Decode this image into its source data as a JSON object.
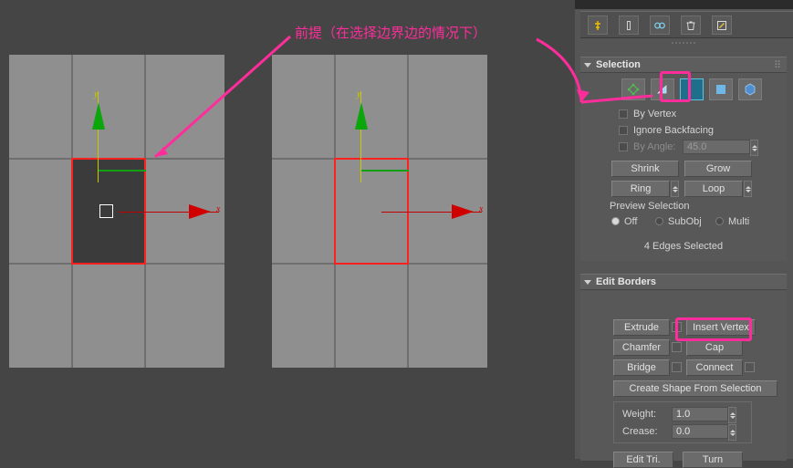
{
  "annotation": {
    "note": "前提（在选择边界边的情况下）",
    "color": "#ff2d9b"
  },
  "viewport": {
    "axis_y_label": "y",
    "axis_x_label": "x",
    "selection_color": "#ff2020"
  },
  "panel": {
    "toolbar": {
      "buttons": [
        {
          "name": "pin-stack-icon",
          "glyph": "⚑"
        },
        {
          "name": "column-icon",
          "glyph": "▍"
        },
        {
          "name": "link-icon",
          "glyph": "⚭"
        },
        {
          "name": "delete-icon",
          "glyph": "Ὕ1"
        },
        {
          "name": "edit-icon",
          "glyph": "✎"
        }
      ]
    },
    "selection": {
      "title": "Selection",
      "subobject_icons": [
        {
          "name": "vertex-icon",
          "label": "Vertex"
        },
        {
          "name": "edge-icon",
          "label": "Edge"
        },
        {
          "name": "border-icon",
          "label": "Border"
        },
        {
          "name": "polygon-icon",
          "label": "Polygon"
        },
        {
          "name": "element-icon",
          "label": "Element"
        }
      ],
      "active_subobject_index": 2,
      "by_vertex": "By Vertex",
      "ignore_backfacing": "Ignore Backfacing",
      "by_angle": "By Angle:",
      "by_angle_value": "45.0",
      "shrink": "Shrink",
      "grow": "Grow",
      "ring": "Ring",
      "loop": "Loop",
      "preview_selection": "Preview Selection",
      "preview_off": "Off",
      "preview_subobj": "SubObj",
      "preview_multi": "Multi",
      "status": "4 Edges Selected"
    },
    "edit_borders": {
      "title": "Edit Borders",
      "extrude": "Extrude",
      "insert_vertex": "Insert Vertex",
      "chamfer": "Chamfer",
      "cap": "Cap",
      "bridge": "Bridge",
      "connect": "Connect",
      "create_shape": "Create Shape From Selection",
      "weight_label": "Weight:",
      "weight_value": "1.0",
      "crease_label": "Crease:",
      "crease_value": "0.0",
      "edit_tri": "Edit Tri.",
      "turn": "Turn"
    }
  }
}
